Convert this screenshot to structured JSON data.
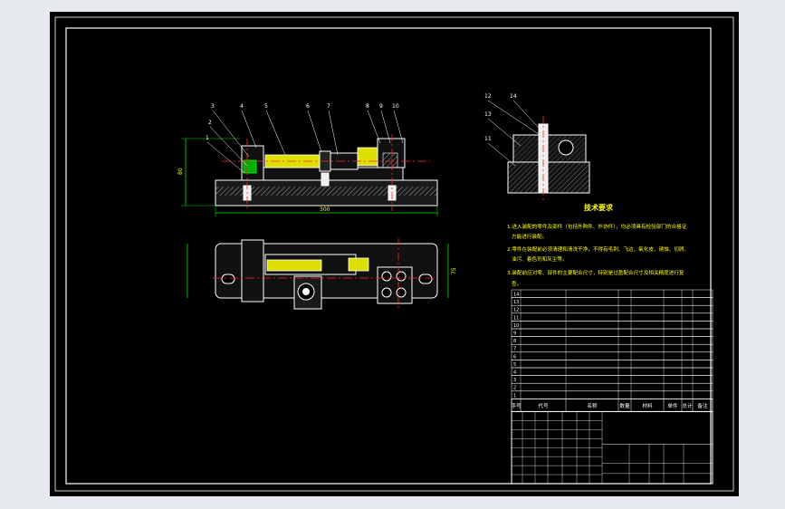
{
  "drawing": {
    "part_balloons_front": [
      "3",
      "2",
      "1",
      "4",
      "5",
      "6",
      "7",
      "8",
      "9",
      "10"
    ],
    "part_balloons_side": [
      "12",
      "14",
      "13",
      "11"
    ],
    "dim_length": "300",
    "dim_height": "80",
    "dim_width": "75"
  },
  "tech_req": {
    "title": "技术要求",
    "lines": [
      "1.进入装配的零件及部件（包括外购件、外协件），均必须具有检验部门的合格证",
      "方能进行装配。",
      "2.零件在装配前必须清理和清洗干净，不得有毛刺、飞边、氧化皮、锈蚀、切屑、",
      "油污、着色剂和灰尘等。",
      "3.装配前应对零、部件的主要配合尺寸，特别是过盈配合尺寸及相关精度进行复",
      "查。"
    ]
  },
  "bom": {
    "header": [
      "序号",
      "代号",
      "名称",
      "数量",
      "材料",
      "单件",
      "总计",
      "备注"
    ],
    "rows": [
      "14",
      "13",
      "12",
      "11",
      "10",
      "9",
      "8",
      "7",
      "6",
      "5",
      "4",
      "3",
      "2",
      "1"
    ]
  },
  "colors": {
    "background": "#000000",
    "outline": "#ffffff",
    "frame": "#ffffff",
    "centerline": "#ff2a2a",
    "dimension": "#00e000",
    "text_yellow": "#ffff00",
    "part_yellow": "#e8e800",
    "hatch": "#c0c0c0",
    "part_green": "#00c000",
    "bg_outer": "#e6e9ee"
  }
}
